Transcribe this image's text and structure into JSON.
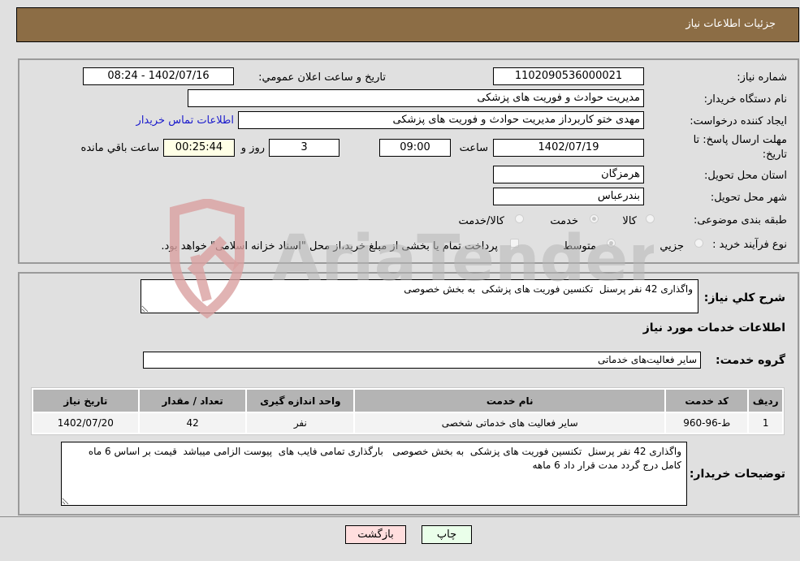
{
  "header": {
    "title": "جزئیات اطلاعات نیاز"
  },
  "form": {
    "need_number": {
      "label": "شماره نیاز:",
      "value": "1102090536000021"
    },
    "announce_datetime": {
      "label": "تاریخ و ساعت اعلان عمومي:",
      "value": "1402/07/16 - 08:24"
    },
    "buyer_org": {
      "label": "نام دستگاه خریدار:",
      "value": "مدیریت حوادث و فوریت های پزشکی"
    },
    "requester": {
      "label": "ایجاد کننده درخواست:",
      "value": "مهدی ختو کاربرداز مدیریت حوادث و فوریت های پزشکی",
      "contact_link": "اطلاعات تماس خریدار"
    },
    "deadline": {
      "label_line1": "مهلت ارسال پاسخ: تا",
      "label_line2": "تاریخ:",
      "date": "1402/07/19",
      "time_label": "ساعت",
      "time": "09:00",
      "days": "3",
      "days_label": "روز و",
      "remaining": "00:25:44",
      "remaining_label": "ساعت باقي مانده"
    },
    "province": {
      "label": "استان محل تحویل:",
      "value": "هرمزگان"
    },
    "city": {
      "label": "شهر محل تحویل:",
      "value": "بندرعباس"
    },
    "category": {
      "label": "طبقه بندی موضوعی:",
      "options": [
        "کالا",
        "خدمت",
        "کالا/خدمت"
      ],
      "selected": "خدمت"
    },
    "purchase_type": {
      "label": "نوع فرآیند خرید :",
      "options": [
        "جزيي",
        "متوسط"
      ],
      "selected": "متوسط",
      "treasury_note": "پرداخت تمام یا بخشی از مبلغ خرید،از محل \"اسناد خزانه اسلامی\" خواهد بود."
    }
  },
  "description": {
    "label": "شرح کلي نیاز:",
    "value": "واگذاری 42 نفر پرسنل  تکنسین فوریت های پزشکی  به بخش خصوصی"
  },
  "services_section": {
    "title": "اطلاعات خدمات مورد نیاز",
    "group_label": "گروه خدمت:",
    "group_value": "سایر فعالیت‌های خدماتی",
    "table": {
      "headers": [
        "ردیف",
        "کد خدمت",
        "نام خدمت",
        "واحد اندازه گیری",
        "تعداد / مقدار",
        "تاریخ نیاز"
      ],
      "rows": [
        [
          "1",
          "ط-96-960",
          "سایر فعالیت های خدماتی شخصی",
          "نفر",
          "42",
          "1402/07/20"
        ]
      ]
    }
  },
  "buyer_notes": {
    "label": "توضیحات خریدار:",
    "value": "واگذاری 42 نفر پرسنل  تکنسین فوریت های پزشکی  به بخش خصوصی   بارگذاری تمامی فایب های  پیوست الزامی میباشد  قیمت بر اساس 6 ماه  کامل درج گردد مدت قرار داد 6 ماهه"
  },
  "buttons": {
    "print": "چاپ",
    "back": "بازگشت"
  },
  "watermark": {
    "text": "AriaTender.neT"
  },
  "colors": {
    "header": "#8c6d45",
    "print_bg": "#eaffea",
    "back_bg": "#ffdede",
    "link": "#1a1acc"
  }
}
